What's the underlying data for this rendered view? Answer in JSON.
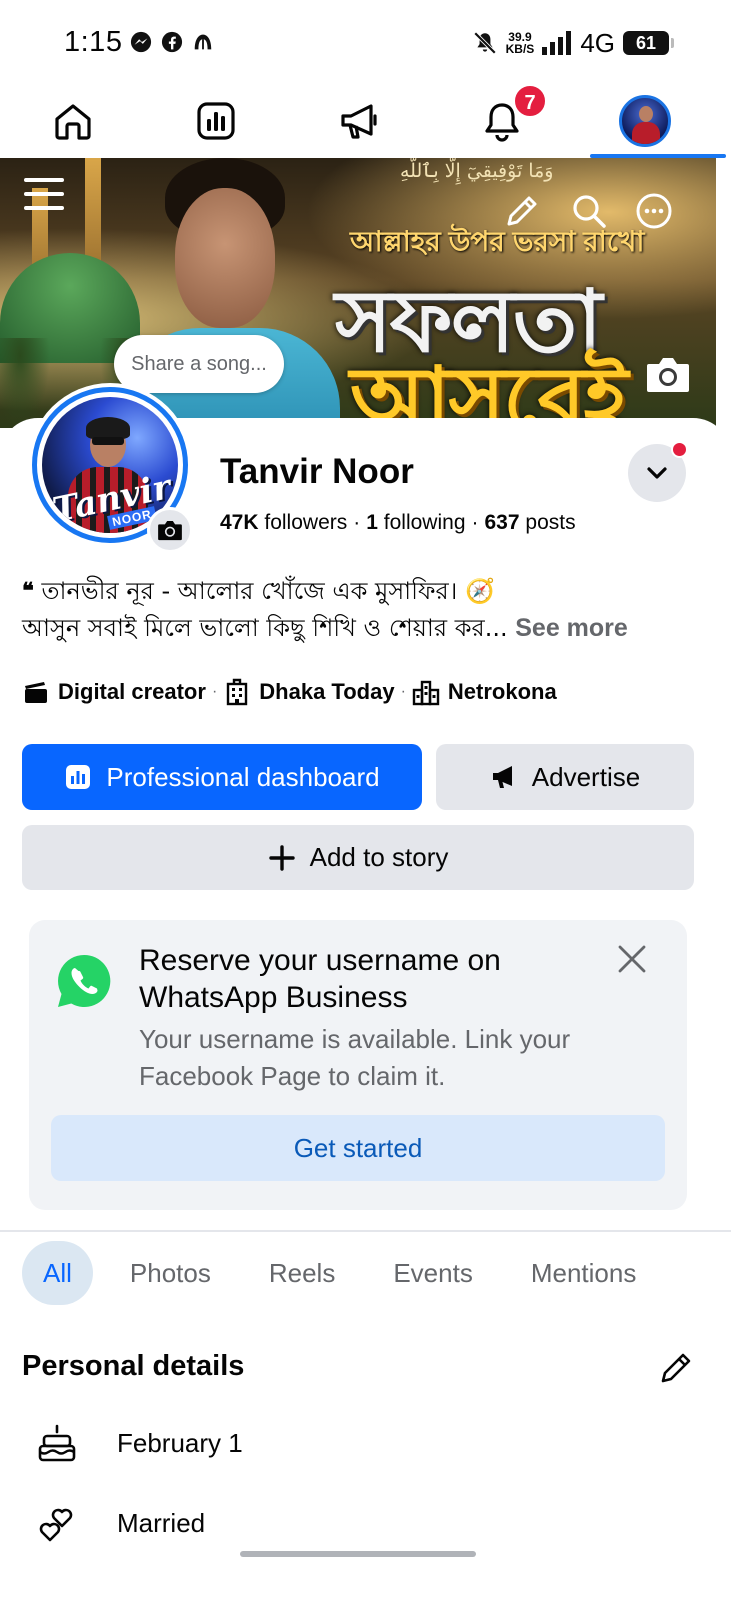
{
  "status_bar": {
    "time": "1:15",
    "speed_value": "39.9",
    "speed_unit": "KB/S",
    "network": "4G",
    "battery": "61",
    "app_icons": [
      "messenger-icon",
      "facebook-icon",
      "app-icon"
    ]
  },
  "nav": {
    "items": [
      "home-icon",
      "dashboard-icon",
      "megaphone-icon",
      "bell-icon",
      "profile-avatar"
    ],
    "notification_count": "7",
    "active_index": 4
  },
  "cover": {
    "arabic_text": "وَمَا تَوْفِيقِيٓ إِلَّا بِٱللَّهِ",
    "subtitle": "আল্লাহর উপর ভরসা রাখো",
    "line1": "সফলতা",
    "line2": "আসবেই"
  },
  "share_song_placeholder": "Share a song...",
  "profile": {
    "name": "Tanvir Noor",
    "followers_count": "47K",
    "followers_label": "followers",
    "following_count": "1",
    "following_label": "following",
    "posts_count": "637",
    "posts_label": "posts",
    "pic_logo": "Tanvir",
    "pic_logo_sub": "NOOR"
  },
  "bio": {
    "line1": "তানভীর নূর - আলোর খোঁজে এক মুসাফির। 🧭",
    "line2": "আসুন সবাই মিলে ভালো কিছু শিখি ও শেয়ার কর...",
    "see_more": "See more"
  },
  "chips": {
    "category": "Digital creator",
    "location1": "Dhaka Today",
    "location2": "Netrokona"
  },
  "buttons": {
    "dashboard": "Professional dashboard",
    "advertise": "Advertise",
    "add_story": "Add to story"
  },
  "whatsapp_card": {
    "title": "Reserve your username on WhatsApp Business",
    "description": "Your username is available. Link your Facebook Page to claim it.",
    "cta": "Get started"
  },
  "tabs": [
    "All",
    "Photos",
    "Reels",
    "Events",
    "Mentions"
  ],
  "personal_details": {
    "title": "Personal details",
    "birthday": "February 1",
    "relationship": "Married"
  },
  "colors": {
    "primary": "#0866ff",
    "badge": "#e41e3f",
    "whatsapp": "#25d366"
  }
}
